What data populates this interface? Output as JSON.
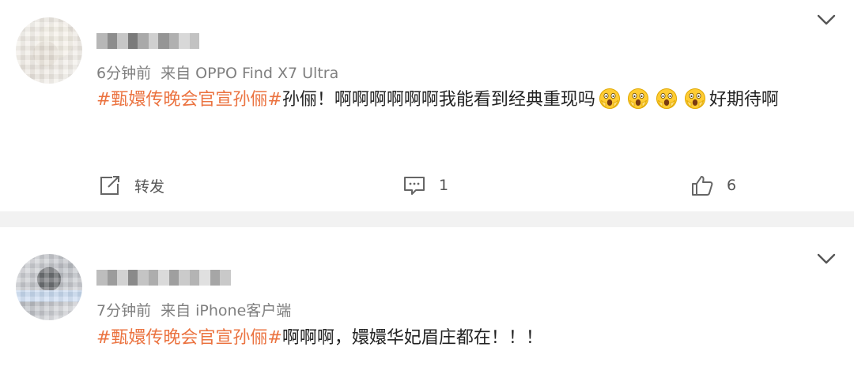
{
  "posts": [
    {
      "time": "6分钟前",
      "source_prefix": "来自",
      "source": "OPPO Find X7 Ultra",
      "hashtag": "#甄嬛传晚会官宣孙俪#",
      "text_before_emoji": "孙俪！啊啊啊啊啊啊我能看到经典重现吗",
      "emoji_count": 4,
      "text_after_emoji": "好期待啊",
      "actions": {
        "repost_label": "转发",
        "comment_count": "1",
        "like_count": "6"
      }
    },
    {
      "time": "7分钟前",
      "source_prefix": "来自",
      "source": "iPhone客户端",
      "hashtag": "#甄嬛传晚会官宣孙俪#",
      "text": "啊啊啊，嬛嬛华妃眉庄都在！！！"
    }
  ],
  "icons": {
    "more": "chevron-down-icon",
    "repost": "share-out-icon",
    "comment": "comment-icon",
    "like": "thumbs-up-icon",
    "emoji": "screaming-face-emoji"
  },
  "colors": {
    "hashtag": "#eb7340",
    "meta": "#7f7f7f",
    "separator": "#f2f2f2"
  }
}
